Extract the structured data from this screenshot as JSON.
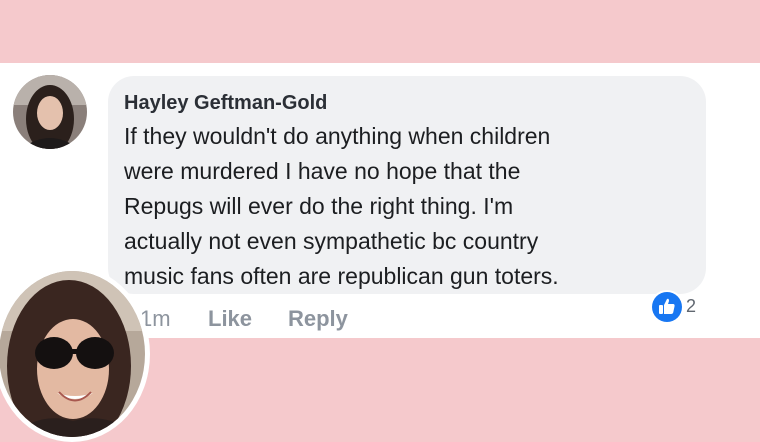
{
  "comment": {
    "author": "Hayley Geftman-Gold",
    "lines": [
      "If they wouldn't do anything when children",
      "were murdered I have no hope that the",
      "Repugs will ever do the right thing.  I'm",
      "actually not even sympathetic bc country",
      "music fans often are republican gun toters."
    ],
    "timestamp": "1m",
    "like_label": "Like",
    "reply_label": "Reply",
    "reaction_count": "2",
    "reaction_icon": "thumbs-up-icon"
  },
  "colors": {
    "page_background": "#f5c9cc",
    "bubble": "#f0f1f3",
    "like_blue": "#1877f2",
    "action_text": "#8d949e"
  }
}
